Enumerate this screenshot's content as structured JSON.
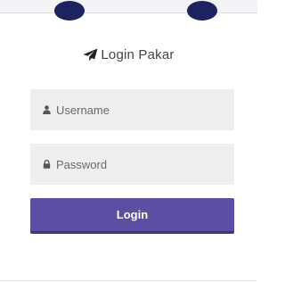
{
  "header": {
    "title": "Login Pakar",
    "title_icon": "paper-plane-icon"
  },
  "form": {
    "username": {
      "placeholder": "Username",
      "icon": "user-icon"
    },
    "password": {
      "placeholder": "Password",
      "icon": "lock-icon"
    },
    "submit_label": "Login"
  },
  "colors": {
    "accent": "#5b4fa3",
    "blob": "#1d2260",
    "field_bg": "#eeeeee"
  }
}
